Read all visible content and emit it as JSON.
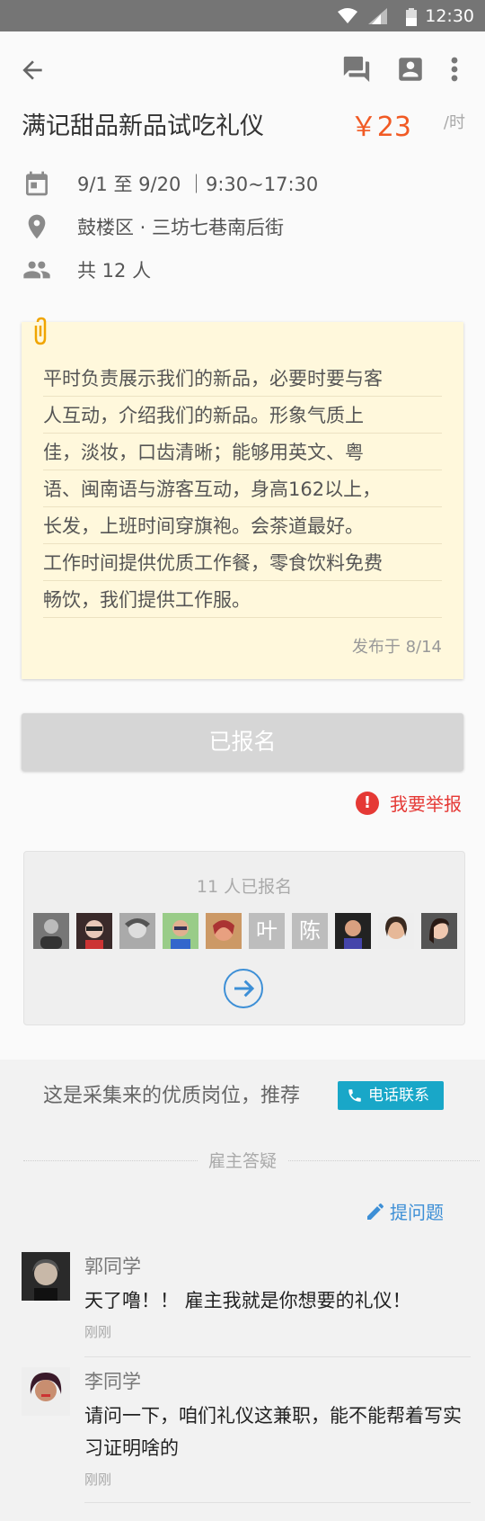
{
  "status_bar": {
    "time": "12:30"
  },
  "job": {
    "title": "满记甜品新品试吃礼仪",
    "price": "￥23",
    "unit": "/时",
    "date": "9/1 至 9/20 ｜9:30~17:30",
    "location": "鼓楼区 · 三坊七巷南后街",
    "people": "共 12 人"
  },
  "description": {
    "lines": [
      "平时负责展示我们的新品，必要时要与客",
      "人互动，介绍我们的新品。形象气质上",
      "佳，淡妆，口齿清晰；能够用英文、粤",
      "语、闽南语与游客互动，身高162以上，",
      "长发，上班时间穿旗袍。会茶道最好。",
      "工作时间提供优质工作餐，零食饮料免费",
      "畅饮，我们提供工作服。"
    ],
    "posted": "发布于 8/14"
  },
  "actions": {
    "applied_label": "已报名",
    "report_label": "我要举报"
  },
  "applicants": {
    "count_label": "11 人已报名",
    "text_avatars": [
      "叶",
      "陈"
    ]
  },
  "recommend": {
    "text": "这是采集来的优质岗位，推荐",
    "call_label": "电话联系"
  },
  "qa": {
    "title": "雇主答疑",
    "ask_label": "提问题",
    "comments": [
      {
        "name": "郭同学",
        "text": "天了噜！！ 雇主我就是你想要的礼仪！",
        "time": "刚刚"
      },
      {
        "name": "李同学",
        "text": "请问一下，咱们礼仪这兼职，能不能帮着写实习证明啥的",
        "time": "刚刚"
      }
    ]
  },
  "colors": {
    "accent_orange": "#f15a24",
    "report_red": "#e53935",
    "link_blue": "#3d8fd6",
    "call_teal": "#19a7c8",
    "note_yellow": "#fff8dc"
  }
}
